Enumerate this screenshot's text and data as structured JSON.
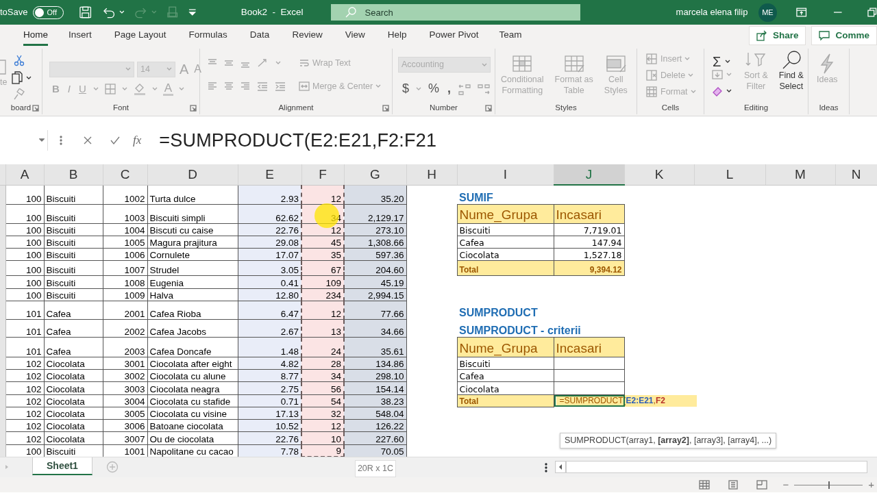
{
  "title_bar": {
    "autosave_label": "toSave",
    "autosave_toggle": {
      "label": "Off",
      "on": false
    },
    "title": "Book2  -  Excel",
    "search": {
      "placeholder": "Search"
    },
    "user": "marcela elena filip",
    "avatar": "ME"
  },
  "quick_access": [
    {
      "kind": "save",
      "disabled": false
    },
    {
      "kind": "undo",
      "disabled": false
    },
    {
      "kind": "redo",
      "disabled": true
    },
    {
      "kind": "print",
      "disabled": true
    },
    {
      "kind": "customize",
      "disabled": false
    }
  ],
  "ribbon_tabs": [
    {
      "label": "Home",
      "selected": true
    },
    {
      "label": "Insert",
      "selected": false
    },
    {
      "label": "Page Layout",
      "selected": false
    },
    {
      "label": "Formulas",
      "selected": false
    },
    {
      "label": "Data",
      "selected": false
    },
    {
      "label": "Review",
      "selected": false
    },
    {
      "label": "View",
      "selected": false
    },
    {
      "label": "Help",
      "selected": false
    },
    {
      "label": "Power Pivot",
      "selected": false
    },
    {
      "label": "Team",
      "selected": false
    }
  ],
  "share": "Share",
  "comments": "Comme",
  "ribbon_groups": [
    {
      "kind": "clipboard",
      "label": "board",
      "paste_label": "te"
    },
    {
      "kind": "font",
      "label": "Font",
      "font_size": "14",
      "grow": "A",
      "shrink": "A",
      "buttons": [
        {
          "label": "B",
          "disabled": true
        },
        {
          "label": "I",
          "disabled": true
        },
        {
          "label": "U",
          "disabled": true
        }
      ],
      "font_color": "A"
    },
    {
      "kind": "alignment",
      "label": "Alignment",
      "buttons": [
        {
          "label": "Wrap Text",
          "disabled": true
        },
        {
          "label": "Merge & Center",
          "disabled": true
        }
      ]
    },
    {
      "kind": "number",
      "label": "Number",
      "format": "Accounting",
      "symbols": [
        "$",
        "%",
        ","
      ]
    },
    {
      "kind": "styles",
      "label": "Styles",
      "buttons": [
        {
          "label": "Conditional\nFormatting",
          "disabled": true
        },
        {
          "label": "Format as\nTable",
          "disabled": true
        },
        {
          "label": "Cell\nStyles",
          "disabled": true
        }
      ]
    },
    {
      "kind": "cells",
      "label": "Cells",
      "buttons": [
        {
          "label": "Insert",
          "disabled": true
        },
        {
          "label": "Delete",
          "disabled": true
        },
        {
          "label": "Format",
          "disabled": true
        }
      ]
    },
    {
      "kind": "editing",
      "label": "Editing",
      "sum_symbol": "Σ",
      "buttons": [
        {
          "label": "Sort &\nFilter",
          "disabled": true
        },
        {
          "label": "Find &\nSelect",
          "disabled": false
        }
      ]
    },
    {
      "kind": "ideas",
      "label": "Ideas",
      "buttons": [
        {
          "label": "Ideas",
          "disabled": true
        }
      ]
    }
  ],
  "formula_bar": {
    "fx": "fx",
    "formula": "=SUMPRODUCT(E2:E21,F2:F21"
  },
  "columns": [
    {
      "label": "A",
      "selected": false
    },
    {
      "label": "B",
      "selected": false
    },
    {
      "label": "C",
      "selected": false
    },
    {
      "label": "D",
      "selected": false
    },
    {
      "label": "E",
      "selected": false,
      "color": "#e9edf8"
    },
    {
      "label": "F",
      "selected": false,
      "color": "#fbe4e4",
      "marquee": true
    },
    {
      "label": "G",
      "selected": false,
      "color": "#d9dee7"
    },
    {
      "label": "H",
      "selected": false
    },
    {
      "label": "I",
      "selected": false
    },
    {
      "label": "J",
      "selected": true
    },
    {
      "label": "K",
      "selected": false
    },
    {
      "label": "L",
      "selected": false
    },
    {
      "label": "M",
      "selected": false
    },
    {
      "label": "N",
      "selected": false
    }
  ],
  "rows": [
    {
      "a": "100",
      "b": "Biscuiti",
      "c": "1002",
      "d": "Turta dulce",
      "e": "2.93",
      "f": "12",
      "g": "35.20"
    },
    {
      "a": "100",
      "b": "Biscuiti",
      "c": "1003",
      "d": "Biscuiti simpli",
      "e": "62.62",
      "f": "34",
      "g": "2,129.17",
      "pointer": true
    },
    {
      "a": "100",
      "b": "Biscuiti",
      "c": "1004",
      "d": "Biscuti cu caise",
      "e": "22.76",
      "f": "12",
      "g": "273.10"
    },
    {
      "a": "100",
      "b": "Biscuiti",
      "c": "1005",
      "d": "Magura prajitura",
      "e": "29.08",
      "f": "45",
      "g": "1,308.66"
    },
    {
      "a": "100",
      "b": "Biscuiti",
      "c": "1006",
      "d": "Cornulete",
      "e": "17.07",
      "f": "35",
      "g": "597.36"
    },
    {
      "a": "100",
      "b": "Biscuiti",
      "c": "1007",
      "d": "Strudel",
      "e": "3.05",
      "f": "67",
      "g": "204.60"
    },
    {
      "a": "100",
      "b": "Biscuiti",
      "c": "1008",
      "d": "Eugenia",
      "e": "0.41",
      "f": "109",
      "g": "45.19"
    },
    {
      "a": "100",
      "b": "Biscuiti",
      "c": "1009",
      "d": "Halva",
      "e": "12.80",
      "f": "234",
      "g": "2,994.15"
    },
    {
      "a": "101",
      "b": "Cafea",
      "c": "2001",
      "d": "Cafea Rioba",
      "e": "6.47",
      "f": "12",
      "g": "77.66"
    },
    {
      "a": "101",
      "b": "Cafea",
      "c": "2002",
      "d": "Cafea Jacobs",
      "e": "2.67",
      "f": "13",
      "g": "34.66"
    },
    {
      "a": "101",
      "b": "Cafea",
      "c": "2003",
      "d": "Cafea Doncafe",
      "e": "1.48",
      "f": "24",
      "g": "35.61"
    },
    {
      "a": "102",
      "b": "Ciocolata",
      "c": "3001",
      "d": "Ciocolata after eight",
      "e": "4.82",
      "f": "28",
      "g": "134.86"
    },
    {
      "a": "102",
      "b": "Ciocolata",
      "c": "3002",
      "d": "Ciocolata cu alune",
      "e": "8.77",
      "f": "34",
      "g": "298.10"
    },
    {
      "a": "102",
      "b": "Ciocolata",
      "c": "3003",
      "d": "Ciocolata neagra",
      "e": "2.75",
      "f": "56",
      "g": "154.14"
    },
    {
      "a": "102",
      "b": "Ciocolata",
      "c": "3004",
      "d": "Ciocolata cu stafide",
      "e": "0.71",
      "f": "54",
      "g": "38.23"
    },
    {
      "a": "102",
      "b": "Ciocolata",
      "c": "3005",
      "d": "Ciocolata cu visine",
      "e": "17.13",
      "f": "32",
      "g": "548.04"
    },
    {
      "a": "102",
      "b": "Ciocolata",
      "c": "3006",
      "d": "Batoane ciocolata",
      "e": "10.52",
      "f": "12",
      "g": "126.22"
    },
    {
      "a": "102",
      "b": "Ciocolata",
      "c": "3007",
      "d": "Ou de ciocolata",
      "e": "22.76",
      "f": "10",
      "g": "227.60"
    },
    {
      "a": "100",
      "b": "Biscuiti",
      "c": "1001",
      "d": "Napolitane cu cacao",
      "e": "7.78",
      "f": "9",
      "g": "70.05"
    }
  ],
  "summary_tables": [
    {
      "titles": [
        "SUMIF"
      ],
      "header": [
        "Nume_Grupa",
        "Incasari"
      ],
      "rows": [
        {
          "group": "Biscuiti",
          "value": "7,719.01"
        },
        {
          "group": "Cafea",
          "value": "147.94"
        },
        {
          "group": "Ciocolata",
          "value": "1,527.18"
        }
      ],
      "total": {
        "label": "Total",
        "value": "9,394.12"
      }
    },
    {
      "titles": [
        "SUMPRODUCT",
        "SUMPRODUCT - criterii"
      ],
      "header": [
        "Nume_Grupa",
        "Incasari"
      ],
      "rows": [
        {
          "group": "Biscuiti"
        },
        {
          "group": "Cafea"
        },
        {
          "group": "Ciocolata"
        }
      ],
      "total": {
        "label": "Total",
        "editing": true,
        "formula_parts": [
          {
            "text": "=SUMPRODUCT("
          },
          {
            "text": "E2:E21",
            "color": "#2e5fb8"
          },
          {
            "text": ","
          },
          {
            "text": "F2",
            "color": "#b8332b"
          }
        ]
      }
    }
  ],
  "tooltip": "SUMPRODUCT(array1, **[array2]**, [array3], [array4], ...)",
  "sheet_tabs": [
    {
      "label": "Sheet1",
      "selected": true
    }
  ],
  "selection_size": "20R x 1C",
  "status_bar": {
    "minus": "−",
    "plus": "+",
    "zoom": {
      "level": 0.5
    }
  }
}
